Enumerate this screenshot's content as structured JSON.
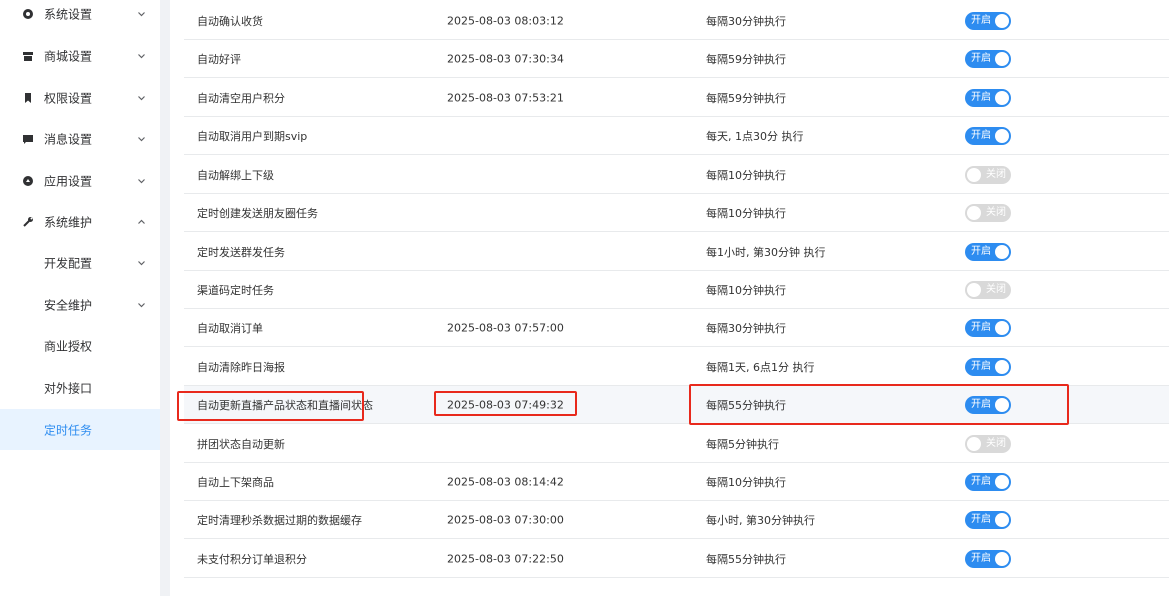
{
  "sidebar": {
    "items": [
      {
        "label": "系统设置",
        "icon": "gear-icon",
        "expanded": false
      },
      {
        "label": "商城设置",
        "icon": "store-icon",
        "expanded": false
      },
      {
        "label": "权限设置",
        "icon": "bookmark-icon",
        "expanded": false
      },
      {
        "label": "消息设置",
        "icon": "message-icon",
        "expanded": false
      },
      {
        "label": "应用设置",
        "icon": "app-icon",
        "expanded": false
      },
      {
        "label": "系统维护",
        "icon": "wrench-icon",
        "expanded": true
      }
    ],
    "subitems": [
      {
        "label": "开发配置",
        "has_children": true
      },
      {
        "label": "安全维护",
        "has_children": true
      },
      {
        "label": "商业授权",
        "has_children": false
      },
      {
        "label": "对外接口",
        "has_children": false
      },
      {
        "label": "定时任务",
        "has_children": false,
        "active": true
      }
    ]
  },
  "tasks": [
    {
      "name": "自动确认收货",
      "time": "2025-08-03 08:03:12",
      "schedule": "每隔30分钟执行",
      "status": "开启",
      "on": true
    },
    {
      "name": "自动好评",
      "time": "2025-08-03 07:30:34",
      "schedule": "每隔59分钟执行",
      "status": "开启",
      "on": true
    },
    {
      "name": "自动清空用户积分",
      "time": "2025-08-03 07:53:21",
      "schedule": "每隔59分钟执行",
      "status": "开启",
      "on": true
    },
    {
      "name": "自动取消用户到期svip",
      "time": "",
      "schedule": "每天, 1点30分 执行",
      "status": "开启",
      "on": true
    },
    {
      "name": "自动解绑上下级",
      "time": "",
      "schedule": "每隔10分钟执行",
      "status": "关闭",
      "on": false
    },
    {
      "name": "定时创建发送朋友圈任务",
      "time": "",
      "schedule": "每隔10分钟执行",
      "status": "关闭",
      "on": false
    },
    {
      "name": "定时发送群发任务",
      "time": "",
      "schedule": "每1小时, 第30分钟 执行",
      "status": "开启",
      "on": true
    },
    {
      "name": "渠道码定时任务",
      "time": "",
      "schedule": "每隔10分钟执行",
      "status": "关闭",
      "on": false
    },
    {
      "name": "自动取消订单",
      "time": "2025-08-03 07:57:00",
      "schedule": "每隔30分钟执行",
      "status": "开启",
      "on": true
    },
    {
      "name": "自动清除昨日海报",
      "time": "",
      "schedule": "每隔1天, 6点1分 执行",
      "status": "开启",
      "on": true
    },
    {
      "name": "自动更新直播产品状态和直播间状态",
      "time": "2025-08-03 07:49:32",
      "schedule": "每隔55分钟执行",
      "status": "开启",
      "on": true,
      "highlighted": true
    },
    {
      "name": "拼团状态自动更新",
      "time": "",
      "schedule": "每隔5分钟执行",
      "status": "关闭",
      "on": false
    },
    {
      "name": "自动上下架商品",
      "time": "2025-08-03 08:14:42",
      "schedule": "每隔10分钟执行",
      "status": "开启",
      "on": true
    },
    {
      "name": "定时清理秒杀数据过期的数据缓存",
      "time": "2025-08-03 07:30:00",
      "schedule": "每小时, 第30分钟执行",
      "status": "开启",
      "on": true
    },
    {
      "name": "未支付积分订单退积分",
      "time": "2025-08-03 07:22:50",
      "schedule": "每隔55分钟执行",
      "status": "开启",
      "on": true
    }
  ],
  "colors": {
    "accent": "#2d8cf0",
    "annotation_red": "#e8291c",
    "toggle_off": "#d9d9d9"
  }
}
